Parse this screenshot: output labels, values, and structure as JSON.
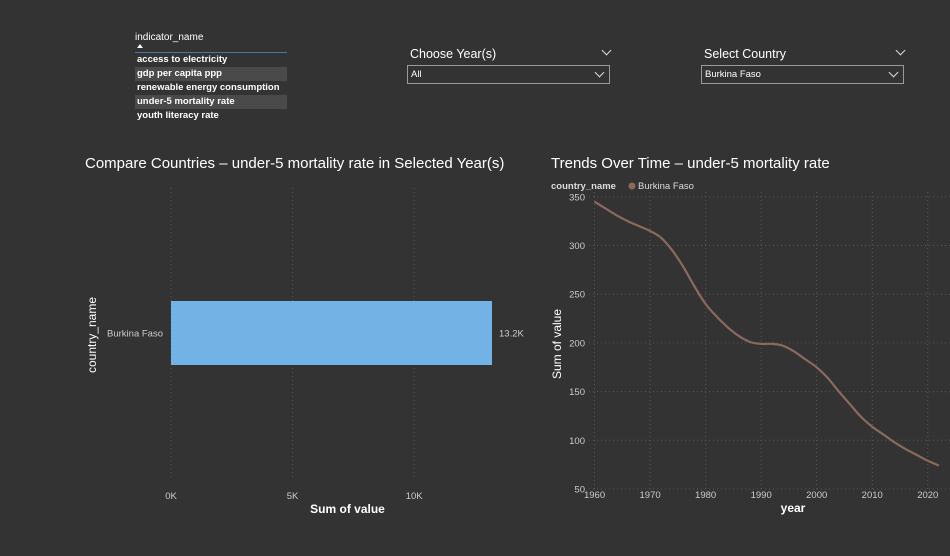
{
  "slicer": {
    "header": "indicator_name",
    "items": [
      {
        "label": "access to electricity",
        "selected": false
      },
      {
        "label": "gdp per capita ppp",
        "selected": true
      },
      {
        "label": "renewable energy consumption",
        "selected": false
      },
      {
        "label": "under-5 mortality rate",
        "selected": true
      },
      {
        "label": "youth literacy rate",
        "selected": false
      }
    ]
  },
  "year_filter": {
    "title": "Choose Year(s)",
    "value": "All"
  },
  "country_filter": {
    "title": "Select Country",
    "value": "Burkina Faso"
  },
  "colors": {
    "background": "#333333",
    "bar": "#73b2e5",
    "line": "#8a6a5e",
    "slicer_line": "#4d74a8"
  },
  "bar_chart": {
    "title": "Compare Countries – under-5 mortality rate in Selected Year(s)",
    "chart_data": {
      "type": "bar",
      "orientation": "horizontal",
      "categories": [
        "Burkina Faso"
      ],
      "values": [
        13200
      ],
      "data_labels": [
        "13.2K"
      ],
      "xlabel": "Sum of value",
      "ylabel": "country_name",
      "xlim": [
        0,
        13200
      ],
      "x_ticks": [
        0,
        5000,
        10000
      ],
      "x_tick_labels": [
        "0K",
        "5K",
        "10K"
      ],
      "grid": true
    }
  },
  "line_chart": {
    "title": "Trends Over Time – under-5 mortality rate",
    "legend_title": "country_name",
    "chart_data": {
      "type": "line",
      "legend_placement": "top-left",
      "series": [
        {
          "name": "Burkina Faso",
          "x": [
            1960,
            1962,
            1964,
            1966,
            1968,
            1970,
            1972,
            1974,
            1976,
            1978,
            1980,
            1982,
            1984,
            1986,
            1988,
            1990,
            1992,
            1994,
            1996,
            1998,
            2000,
            2002,
            2004,
            2006,
            2008,
            2010,
            2012,
            2014,
            2016,
            2018,
            2020,
            2022
          ],
          "y": [
            345,
            338,
            331,
            325,
            320,
            315,
            308,
            295,
            278,
            258,
            240,
            227,
            216,
            207,
            201,
            199,
            199,
            197,
            191,
            183,
            175,
            164,
            150,
            137,
            124,
            114,
            106,
            98,
            91,
            85,
            79,
            74
          ]
        }
      ],
      "xlabel": "year",
      "ylabel": "Sum of value",
      "xlim": [
        1959,
        2024
      ],
      "ylim": [
        50,
        355
      ],
      "x_ticks": [
        1960,
        1970,
        1980,
        1990,
        2000,
        2010,
        2020
      ],
      "y_ticks": [
        50,
        100,
        150,
        200,
        250,
        300,
        350
      ],
      "grid": true
    }
  }
}
